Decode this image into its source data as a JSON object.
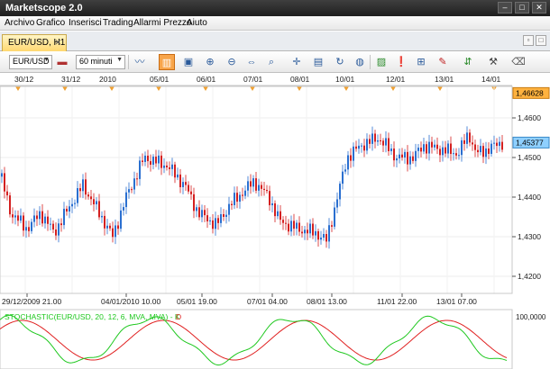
{
  "window": {
    "title": "Marketscope 2.0"
  },
  "menu": [
    "Archivo",
    "Grafico",
    "Inserisci",
    "Trading",
    "Allarmi Prezzo",
    "Aiuto"
  ],
  "tab": {
    "label": "EUR/USD, H1",
    "close": "✕"
  },
  "toolbar": {
    "symbol": "EUR/USD",
    "timeframe": "60 minuti"
  },
  "top_dates": [
    "30/12",
    "31/12",
    "2010",
    "05/01",
    "06/01",
    "07/01",
    "08/01",
    "10/01",
    "12/01",
    "13/01",
    "14/01"
  ],
  "bottom_dates": [
    "29/12/2009 21.00",
    "04/01/2010 10.00",
    "05/01 19.00",
    "07/01 04.00",
    "08/01 13.00",
    "11/01 22.00",
    "13/01 07.00"
  ],
  "price_axis": {
    "ticks": [
      "1,4600",
      "1,4500",
      "1,4400",
      "1,4300",
      "1,4200"
    ],
    "high_label": "1,46628",
    "current_label": "1,45377"
  },
  "stochastic": {
    "label": "STOCHASTIC(EUR/USD, 20, 12, 6, MVA, MVA) - K",
    "label_d": "D",
    "axis_top": "100,0000",
    "color_k": "#1fc81f",
    "color_d": "#e02020"
  },
  "colors": {
    "bull": "#2a6fd0",
    "bear": "#d42020",
    "accent": "#f8a54a"
  }
}
